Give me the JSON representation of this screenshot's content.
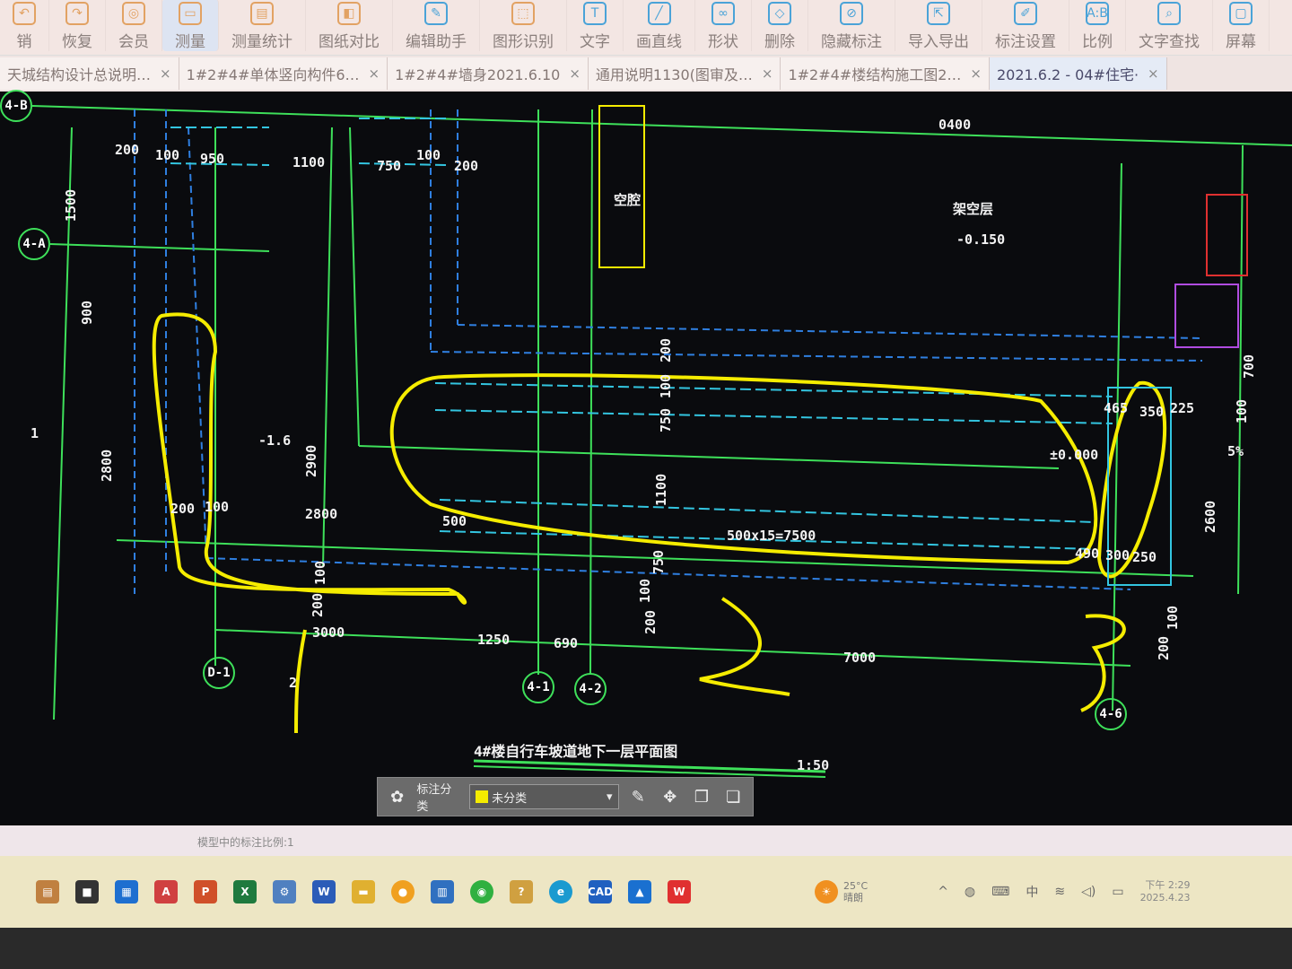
{
  "toolbar": {
    "items": [
      "销",
      "恢复",
      "会员",
      "测量",
      "测量统计",
      "图纸对比",
      "编辑助手",
      "图形识别",
      "文字",
      "画直线",
      "形状",
      "删除",
      "隐藏标注",
      "导入导出",
      "标注设置",
      "比例",
      "文字查找",
      "屏幕"
    ],
    "active": "测量"
  },
  "tabs": [
    "天城结构设计总说明…",
    "1#2#4#单体竖向构件6…",
    "1#2#4#墙身2021.6.10",
    "通用说明1130(图审及…",
    "1#2#4#楼结构施工图2…",
    "2021.6.2 - 04#住宅·"
  ],
  "tab_close": "×",
  "drawing": {
    "axes": [
      "4-B",
      "4-A",
      "D-1",
      "4-1",
      "4-2",
      "4-6"
    ],
    "labels": [
      "200",
      "100",
      "950",
      "1100",
      "750",
      "100",
      "200",
      "1500",
      "900",
      "2800",
      "2900",
      "-1.6",
      "200",
      "100",
      "2800",
      "100",
      "200",
      "500",
      "3000",
      "1250",
      "690",
      "7000",
      "500x15=7500",
      "1100",
      "750",
      "100",
      "200",
      "750",
      "100",
      "200",
      "465",
      "350",
      "225",
      "±0.000",
      "490",
      "300",
      "250",
      "700",
      "100",
      "2600",
      "100",
      "200",
      "架空层",
      "-0.150",
      "空腔",
      "0400",
      "5%",
      "1",
      "2"
    ],
    "title": "4#楼自行车坡道地下一层平面图",
    "scale": "1:50",
    "annotation_color": "#f5ec00"
  },
  "float_toolbar": {
    "category_label": "标注分类",
    "selected": "未分类"
  },
  "status": "模型中的标注比例:1",
  "taskbar": {
    "weather_temp": "25°C",
    "weather_text": "晴朗",
    "ime": "中",
    "time": "下午 2:29",
    "date": "2025.4.23"
  }
}
